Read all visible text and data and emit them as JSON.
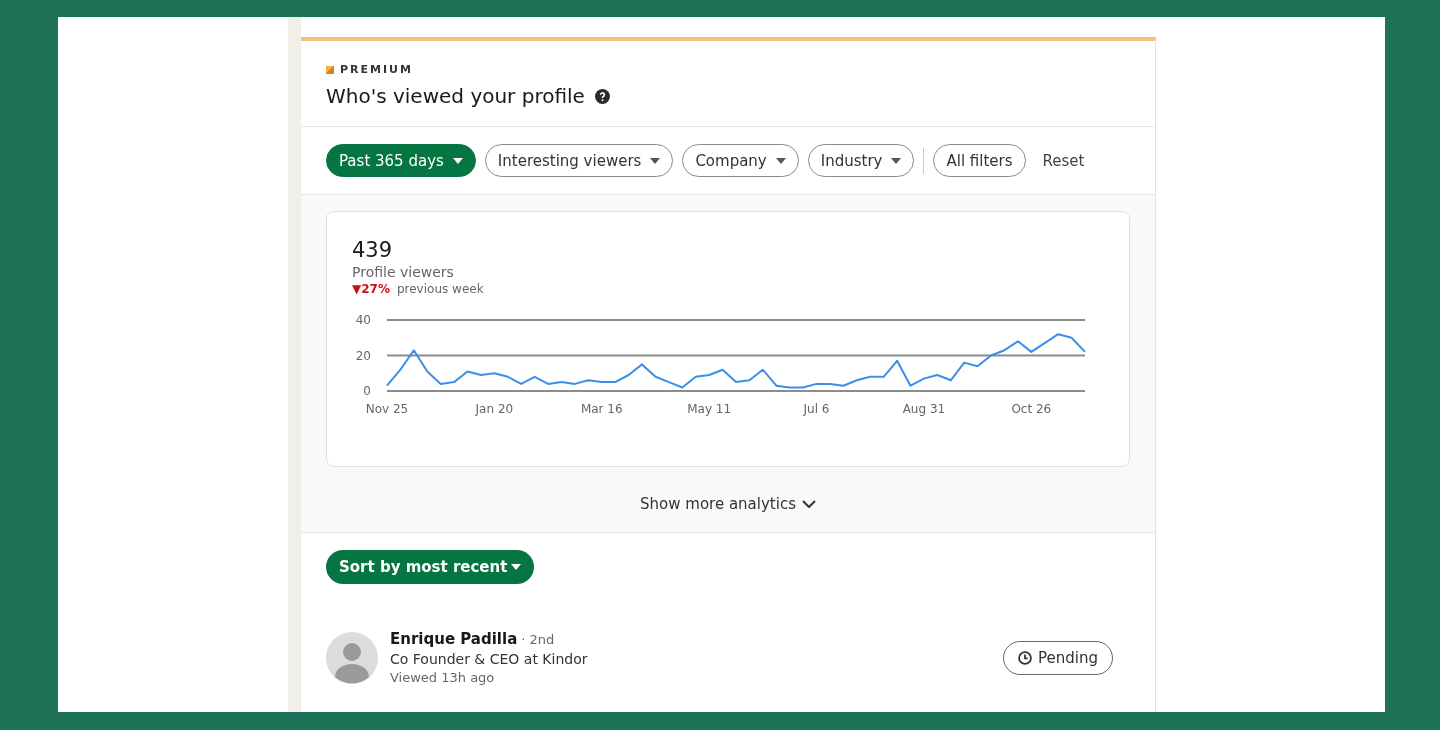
{
  "badge": {
    "label": "PREMIUM"
  },
  "header": {
    "title": "Who's viewed your profile"
  },
  "filters": [
    {
      "label": "Past 365 days",
      "selected": true,
      "dropdown": true
    },
    {
      "label": "Interesting viewers",
      "selected": false,
      "dropdown": true
    },
    {
      "label": "Company",
      "selected": false,
      "dropdown": true
    },
    {
      "label": "Industry",
      "selected": false,
      "dropdown": true
    },
    {
      "label": "All filters",
      "selected": false,
      "dropdown": false
    }
  ],
  "reset": "Reset",
  "summary": {
    "count": "439",
    "label": "Profile viewers",
    "change": "▼27%",
    "change_note": "previous week"
  },
  "chart_data": {
    "type": "line",
    "categories": [
      "Nov 25",
      null,
      null,
      null,
      null,
      null,
      null,
      null,
      "Jan 20",
      null,
      null,
      null,
      null,
      null,
      null,
      null,
      "Mar 16",
      null,
      null,
      null,
      null,
      null,
      null,
      null,
      "May 11",
      null,
      null,
      null,
      null,
      null,
      null,
      null,
      "Jul 6",
      null,
      null,
      null,
      null,
      null,
      null,
      null,
      "Aug 31",
      null,
      null,
      null,
      null,
      null,
      null,
      null,
      "Oct 26",
      null,
      null,
      null,
      null
    ],
    "series": [
      {
        "color": "#3b8fe8",
        "values": [
          3,
          12,
          23,
          11,
          4,
          5,
          11,
          9,
          10,
          8,
          4,
          8,
          4,
          5,
          4,
          6,
          5,
          5,
          9,
          15,
          8,
          5,
          2,
          8,
          9,
          12,
          5,
          6,
          12,
          3,
          2,
          2,
          4,
          4,
          3,
          6,
          8,
          8,
          17,
          3,
          7,
          9,
          6,
          16,
          14,
          20,
          23,
          28,
          22,
          27,
          32,
          30,
          22
        ]
      }
    ],
    "ylim": [
      0,
      40
    ],
    "yticks": [
      0,
      20,
      40
    ]
  },
  "show_more": "Show more analytics",
  "sort": {
    "label": "Sort by most recent"
  },
  "viewers": [
    {
      "name": "Enrique Padilla",
      "degree": "· 2nd",
      "headline": "Co Founder & CEO at Kindor",
      "viewed": "Viewed 13h ago",
      "action": "Pending"
    }
  ]
}
